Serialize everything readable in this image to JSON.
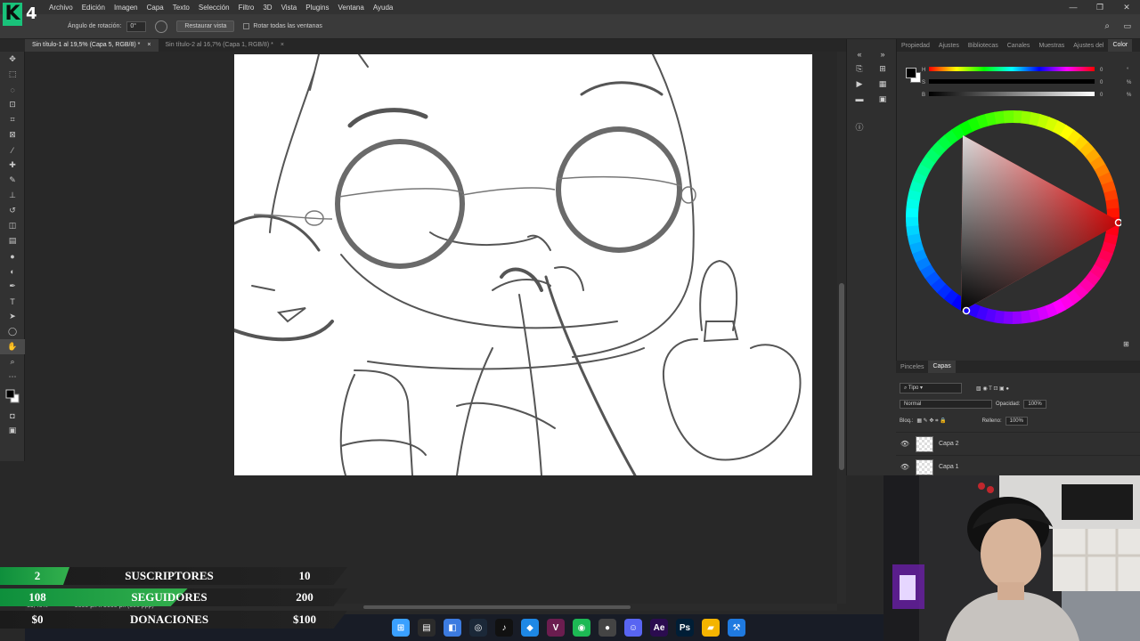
{
  "app": {
    "menu": [
      "Archivo",
      "Edición",
      "Imagen",
      "Capa",
      "Texto",
      "Selección",
      "Filtro",
      "3D",
      "Vista",
      "Plugins",
      "Ventana",
      "Ayuda"
    ],
    "logo_letter": "K",
    "logo_number": "4",
    "window_controls": {
      "minimize": "—",
      "maximize": "❐",
      "close": "✕"
    }
  },
  "options": {
    "angle_label": "Ángulo de rotación:",
    "angle_value": "0°",
    "reset_view": "Restaurar vista",
    "rotate_all": "Rotar todas las ventanas"
  },
  "tabs": [
    {
      "label": "Sin título-1 al 19,5% (Capa 5, RGB/8) *",
      "close": "×"
    },
    {
      "label": "Sin título-2 al 16,7% (Capa 1, RGB/8) *",
      "close": "×"
    }
  ],
  "status": {
    "zoom": "19,46%",
    "size": "5000 px x 5000 px (300 ppp)"
  },
  "panel": {
    "tabs": [
      "Propiedad",
      "Ajustes",
      "Bibliotecas",
      "Canales",
      "Muestras",
      "Ajustes del",
      "Color"
    ],
    "sliders": [
      {
        "label": "H",
        "value": "0",
        "unit": "°"
      },
      {
        "label": "S",
        "value": "0",
        "unit": "%"
      },
      {
        "label": "B",
        "value": "0",
        "unit": "%"
      }
    ],
    "hue_color": "#ff0000"
  },
  "layers_panel": {
    "tabs": [
      "Pinceles",
      "Capas"
    ],
    "filter_label": "Tipo",
    "blend_mode": "Normal",
    "opacity_label": "Opacidad:",
    "opacity_value": "100%",
    "lock_label": "Bloq.:",
    "fill_label": "Relleno:",
    "fill_value": "100%",
    "layers": [
      {
        "name": "Capa 2"
      },
      {
        "name": "Capa 1"
      }
    ]
  },
  "overlay": {
    "rows": [
      {
        "current": "2",
        "title": "SUSCRIPTORES",
        "goal": "10",
        "progress": 0.2
      },
      {
        "current": "108",
        "title": "SEGUIDORES",
        "goal": "200",
        "progress": 0.54
      },
      {
        "current": "$0",
        "title": "DONACIONES",
        "goal": "$100",
        "progress": 0
      }
    ]
  },
  "taskbar_icons": [
    "windows-icon",
    "file-explorer-icon",
    "store-icon",
    "steam-icon",
    "tiktok-icon",
    "maps-icon",
    "vegas-icon",
    "spotify-icon",
    "obs-icon",
    "discord-icon",
    "after-effects-icon",
    "photoshop-icon",
    "folder-icon",
    "xcode-icon"
  ]
}
